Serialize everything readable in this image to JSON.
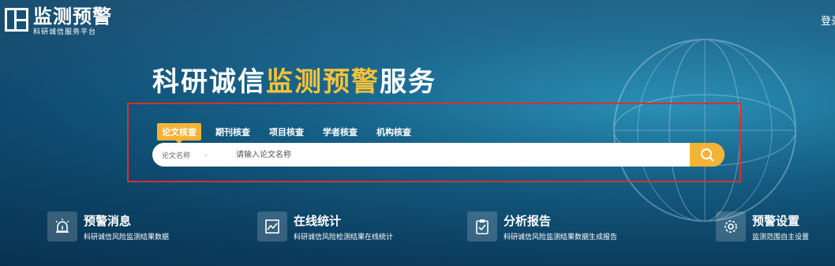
{
  "header": {
    "logo_title": "监测预警",
    "logo_subtitle": "科研诚信服务平台",
    "login_label": "登录"
  },
  "hero": {
    "title_prefix": "科研诚信",
    "title_highlight": "监测预警",
    "title_suffix": "服务"
  },
  "search": {
    "tabs": [
      "论文核查",
      "期刊核查",
      "项目核查",
      "学者核查",
      "机构核查"
    ],
    "active_tab": 0,
    "select_value": "论文名称",
    "placeholder": "请输入论文名称"
  },
  "features": [
    {
      "title": "预警消息",
      "desc": "科研诚信风险监测结果数据",
      "icon": "alarm-icon"
    },
    {
      "title": "在线统计",
      "desc": "科研诚信风险检测结果在线统计",
      "icon": "chart-icon"
    },
    {
      "title": "分析报告",
      "desc": "科研诚信风险监测结果数据生成报告",
      "icon": "clipboard-check-icon"
    },
    {
      "title": "预警设置",
      "desc": "监测范围自主设置",
      "icon": "gear-icon"
    }
  ],
  "colors": {
    "accent": "#f5b335",
    "highlight": "#f5c239",
    "frame": "#d8302f"
  }
}
